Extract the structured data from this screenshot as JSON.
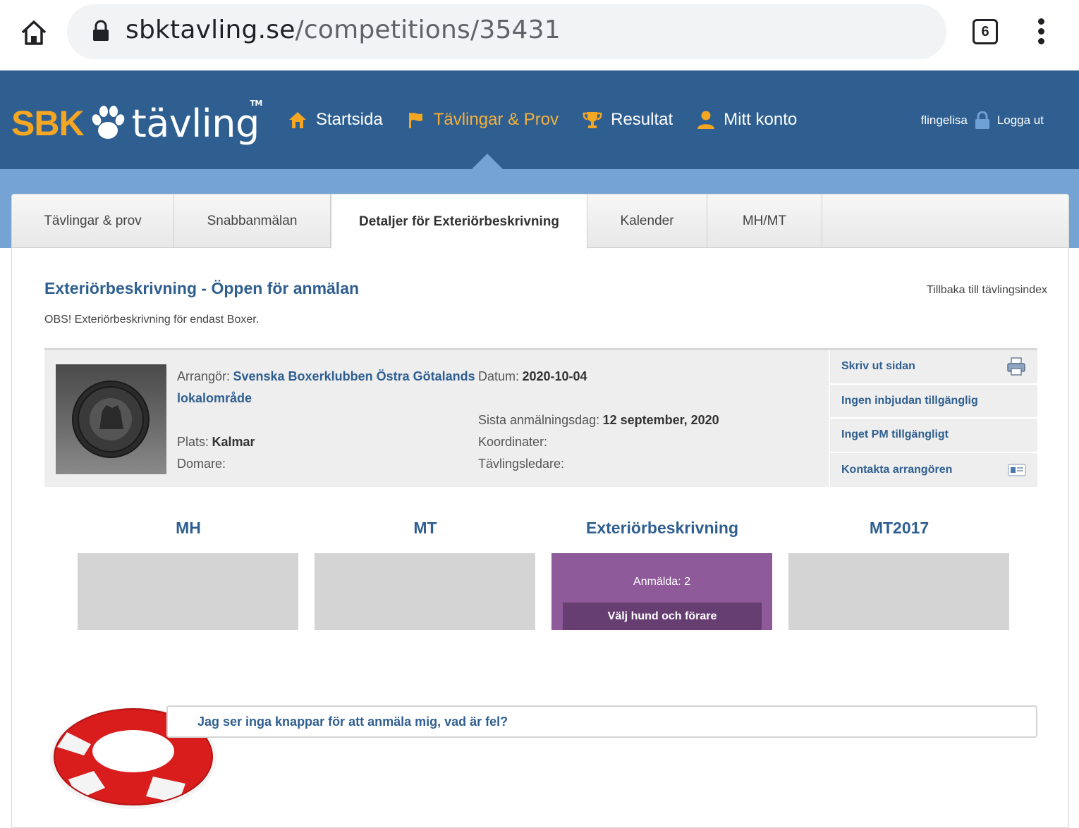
{
  "browser": {
    "url_domain": "sbktavling.se",
    "url_path": "/competitions/35431",
    "tab_count": "6"
  },
  "header": {
    "logo_brand": "SBK",
    "logo_word": "tävling",
    "logo_tm": "TM",
    "nav": [
      {
        "label": "Startsida"
      },
      {
        "label": "Tävlingar & Prov"
      },
      {
        "label": "Resultat"
      },
      {
        "label": "Mitt konto"
      }
    ],
    "username": "flingelisa",
    "logout": "Logga ut"
  },
  "subtabs": [
    {
      "label": "Tävlingar & prov"
    },
    {
      "label": "Snabbanmälan"
    },
    {
      "label": "Detaljer för Exteriörbeskrivning"
    },
    {
      "label": "Kalender"
    },
    {
      "label": "MH/MT"
    }
  ],
  "page": {
    "title": "Exteriörbeskrivning - Öppen för anmälan",
    "back_link": "Tillbaka till tävlingsindex",
    "note": "OBS! Exteriörbeskrivning för endast Boxer."
  },
  "info": {
    "organizer_label": "Arrangör:",
    "organizer_line1": "Svenska Boxerklubben Östra Götalands",
    "organizer_line2": "lokalområde",
    "place_label": "Plats:",
    "place_value": "Kalmar",
    "judge_label": "Domare:",
    "date_label": "Datum:",
    "date_value": "2020-10-04",
    "deadline_label": "Sista anmälningsdag:",
    "deadline_value": "12 september, 2020",
    "coords_label": "Koordinater:",
    "leader_label": "Tävlingsledare:",
    "side_links": [
      {
        "label": "Skriv ut sidan"
      },
      {
        "label": "Ingen inbjudan tillgänglig"
      },
      {
        "label": "Inget PM tillgängligt"
      },
      {
        "label": "Kontakta arrangören"
      }
    ]
  },
  "categories": [
    {
      "title": "MH"
    },
    {
      "title": "MT"
    },
    {
      "title": "Exteriörbeskrivning",
      "count": "Anmälda: 2",
      "button": "Välj hund och förare"
    },
    {
      "title": "MT2017"
    }
  ],
  "help": {
    "question": "Jag ser inga knappar för att anmäla mig, vad är fel?"
  },
  "colors": {
    "header_blue": "#2f5f90",
    "band_blue": "#74a3d4",
    "accent_orange": "#f5a623",
    "active_purple": "#8e5a99",
    "button_purple": "#673e72"
  }
}
